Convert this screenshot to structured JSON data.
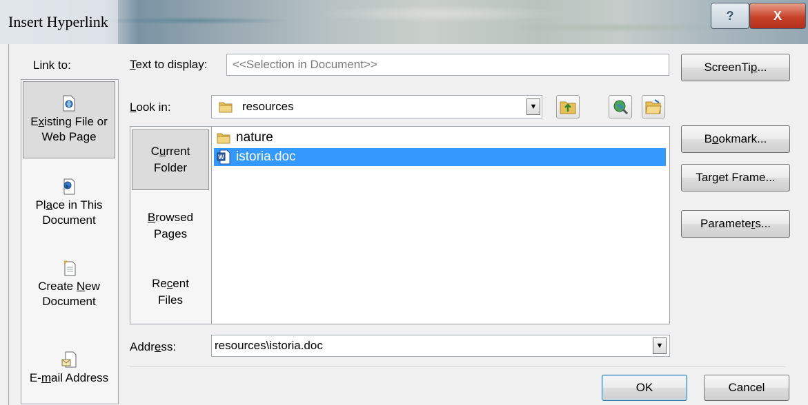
{
  "window": {
    "title": "Insert Hyperlink",
    "help_label": "?",
    "close_label": "X"
  },
  "link_to": {
    "label": "Link to:",
    "items": [
      {
        "label_pre": "E",
        "label_u": "x",
        "label_post": "isting File or",
        "label_line2": "Web Page",
        "icon": "existing-file-icon",
        "selected": true
      },
      {
        "label_pre": "Pl",
        "label_u": "a",
        "label_post": "ce in This",
        "label_line2": "Document",
        "icon": "place-in-document-icon",
        "selected": false
      },
      {
        "label_pre": "Create ",
        "label_u": "N",
        "label_post": "ew",
        "label_line2": "Document",
        "icon": "create-new-document-icon",
        "selected": false
      },
      {
        "label_pre": "E-",
        "label_u": "m",
        "label_post": "ail Address",
        "label_line2": "",
        "icon": "email-address-icon",
        "selected": false
      }
    ]
  },
  "text_to_display": {
    "label_u": "T",
    "label_rest": "ext to display:",
    "value": "<<Selection in Document>>"
  },
  "look_in": {
    "label_u": "L",
    "label_rest": "ook in:",
    "value": "resources"
  },
  "nav": {
    "items": [
      {
        "line1_pre": "C",
        "line1_u": "u",
        "line1_post": "rrent",
        "line2": "Folder",
        "selected": true
      },
      {
        "line1_pre": "",
        "line1_u": "B",
        "line1_post": "rowsed",
        "line2": "Pages",
        "selected": false
      },
      {
        "line1_pre": "Re",
        "line1_u": "c",
        "line1_post": "ent",
        "line2": "Files",
        "selected": false
      }
    ]
  },
  "files": [
    {
      "name": "nature",
      "icon": "folder-icon",
      "selected": false
    },
    {
      "name": "istoria.doc",
      "icon": "word-document-icon",
      "selected": true
    }
  ],
  "address": {
    "label_pre": "Addr",
    "label_u": "e",
    "label_post": "ss:",
    "value": "resources\\istoria.doc"
  },
  "buttons": {
    "screentip": {
      "pre": "ScreenTi",
      "u": "p",
      "post": "..."
    },
    "bookmark": {
      "pre": "B",
      "u": "o",
      "post": "okmark..."
    },
    "target_frame": {
      "pre": "Tar",
      "u": "g",
      "post": "et Frame..."
    },
    "parameters": {
      "pre": "Paramete",
      "u": "r",
      "post": "s..."
    },
    "ok": "OK",
    "cancel": "Cancel"
  }
}
